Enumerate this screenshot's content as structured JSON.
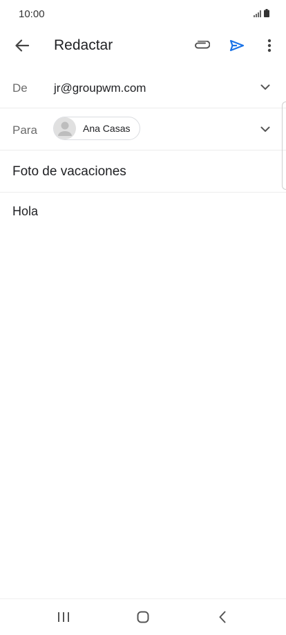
{
  "status_bar": {
    "time": "10:00"
  },
  "app_bar": {
    "title": "Redactar"
  },
  "from": {
    "label": "De",
    "value": "jr@groupwm.com"
  },
  "to": {
    "label": "Para",
    "recipient": "Ana Casas"
  },
  "subject": {
    "value": "Foto de vacaciones"
  },
  "body": {
    "text": "Hola"
  },
  "colors": {
    "accent": "#1a73e8",
    "icon": "#5f6368",
    "divider": "#ececec"
  },
  "icons": {
    "back": "arrow-left-icon",
    "attach": "paperclip-icon",
    "send": "send-icon",
    "more": "more-vert-icon",
    "expand": "chevron-down-icon"
  }
}
